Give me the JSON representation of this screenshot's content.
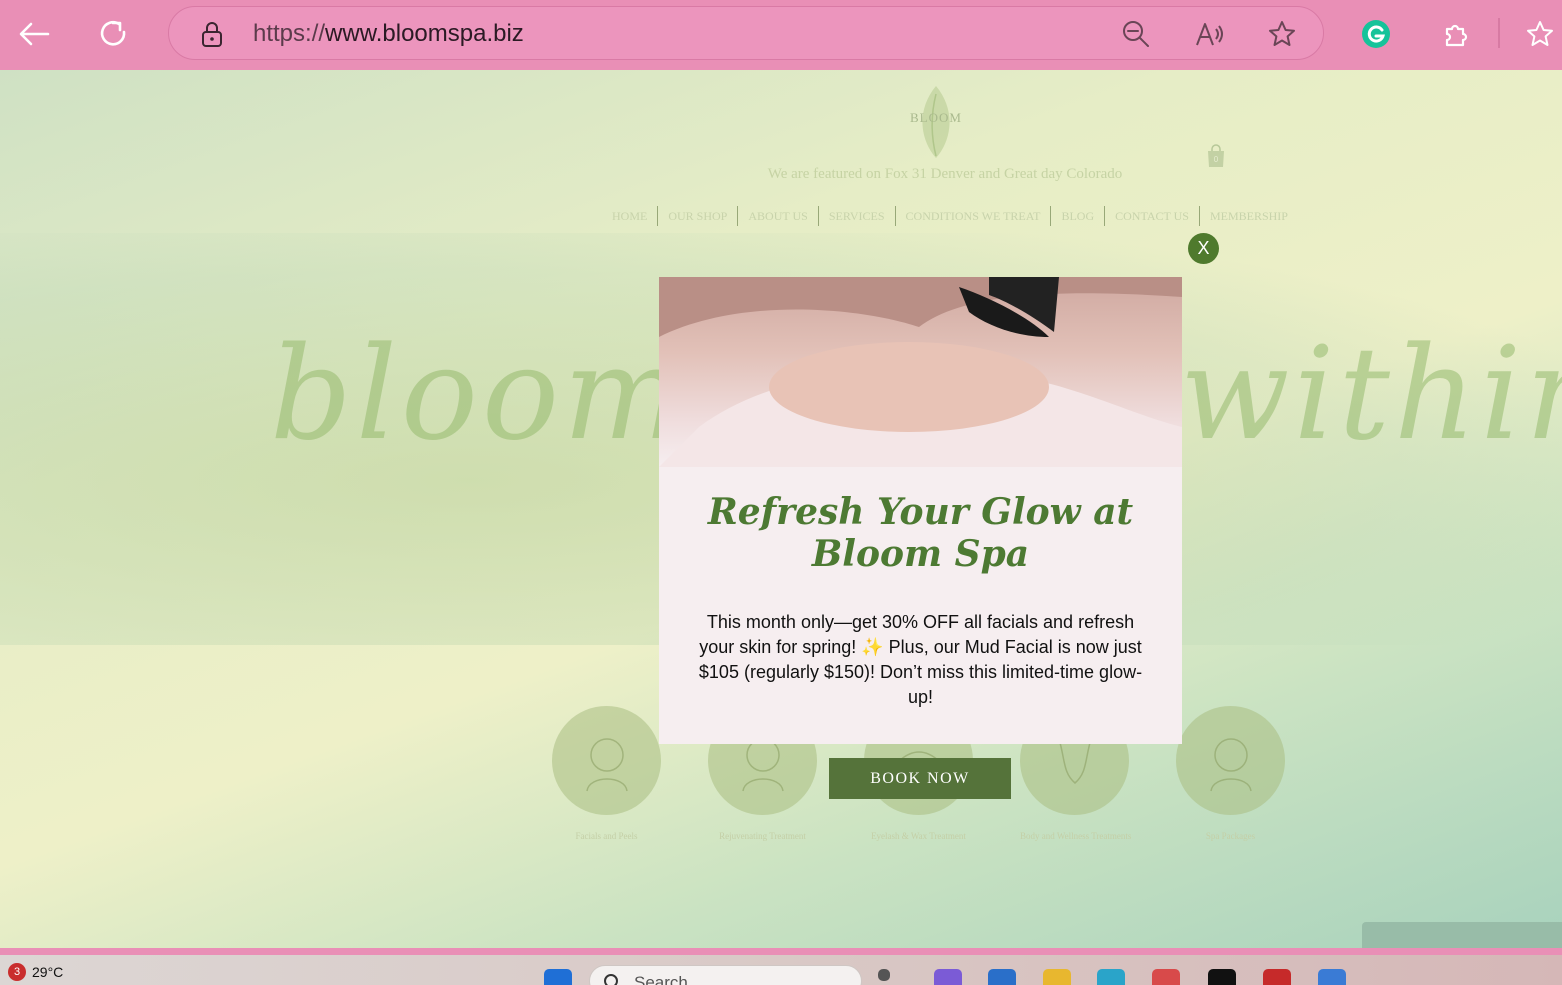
{
  "browser": {
    "url": "https://www.bloomspa.biz",
    "url_prefix": "https://",
    "url_host": "www.bloomspa.biz"
  },
  "site": {
    "logo_text": "BLOOM",
    "featured_text": "We are featured on Fox 31 Denver and Great day Colorado",
    "cart_count": "0",
    "menu": [
      "HOME",
      "OUR SHOP",
      "ABOUT US",
      "SERVICES",
      "CONDITIONS WE TREAT",
      "BLOG",
      "CONTACT US",
      "MEMBERSHIP"
    ],
    "hero_script_left": "bloom",
    "hero_script_right": "within",
    "categories": [
      {
        "label": "Facials and Peels"
      },
      {
        "label": "Rejuvenating Treatment"
      },
      {
        "label": "Eyelash & Wax Treatment"
      },
      {
        "label": "Body and Wellness  Treatments"
      },
      {
        "label": "Spa Packages"
      }
    ]
  },
  "popup": {
    "close_label": "X",
    "headline": "Refresh Your Glow at Bloom Spa",
    "body": "This month only—get 30% OFF all facials and refresh your skin for spring! ✨ Plus, our Mud Facial is now just $105 (regularly $150)! Don’t miss this limited-time glow-up!",
    "button_label": "BOOK NOW"
  },
  "taskbar": {
    "notification_count": "3",
    "temperature": "29°C",
    "search_placeholder": "Search"
  },
  "colors": {
    "chrome_pink": "#e98fb6",
    "brand_green": "#55733a",
    "close_green": "#4f7a2d"
  }
}
